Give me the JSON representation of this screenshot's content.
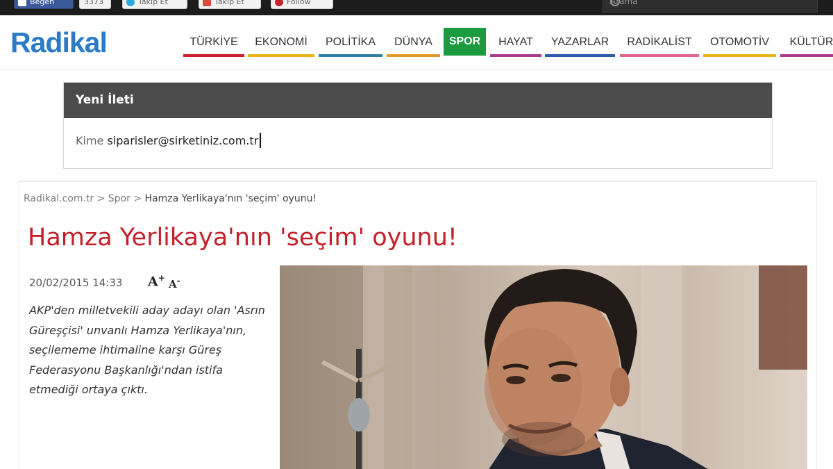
{
  "social": {
    "facebook_label": "Beğen",
    "facebook_count": "3373",
    "twitter_label": "Takip Et",
    "googleplus_label": "Takip Et",
    "follow_label": "Follow",
    "search_placeholder": "Arama"
  },
  "header": {
    "logo": "Radikal",
    "nav": [
      {
        "label": "TÜRKİYE",
        "color": "#c8202b"
      },
      {
        "label": "EKONOMİ",
        "color": "#e8b618"
      },
      {
        "label": "POLİTİKA",
        "color": "#2d7fa3"
      },
      {
        "label": "DÜNYA",
        "color": "#e39a2c"
      },
      {
        "label": "SPOR",
        "color": "#1c9a3f",
        "active": true
      },
      {
        "label": "HAYAT",
        "color": "#a93a8f"
      },
      {
        "label": "YAZARLAR",
        "color": "#2a5aa8"
      },
      {
        "label": "RADİKALİST",
        "color": "#e0658c"
      },
      {
        "label": "OTOMOTİV",
        "color": "#e8b618"
      },
      {
        "label": "KÜLTÜR",
        "color": "#a93a8f"
      }
    ]
  },
  "compose": {
    "title": "Yeni İleti",
    "to_label": "Kime",
    "to_value": "siparisler@sirketiniz.com.tr"
  },
  "article": {
    "breadcrumb": [
      "Radikal.com.tr",
      "Spor",
      "Hamza Yerlikaya'nın 'seçim' oyunu!"
    ],
    "breadcrumb_sep": ">",
    "title": "Hamza Yerlikaya'nın 'seçim' oyunu!",
    "date": "20/02/2015 14:33",
    "font_increase": "A",
    "font_increase_sign": "+",
    "font_decrease": "A",
    "font_decrease_sign": "-",
    "summary": "AKP'den milletvekili aday adayı olan 'Asrın Güreşçisi' unvanlı Hamza Yerlikaya'nın, seçilememe ihtimaline karşı Güreş Federasyonu Başkanlığı'ndan istifa etmediği ortaya çıktı."
  }
}
